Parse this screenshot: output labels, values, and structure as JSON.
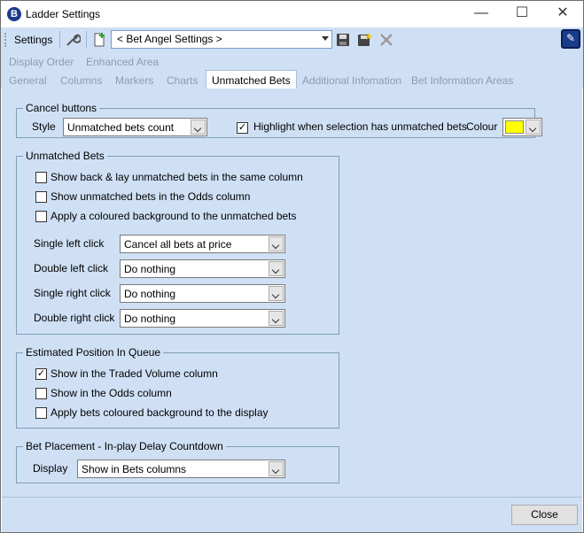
{
  "window": {
    "title": "Ladder Settings",
    "app_icon_letter": "B",
    "minimize": "—",
    "maximize": "☐",
    "close": "✕"
  },
  "toolbar": {
    "settings_label": "Settings",
    "settings_combo_value": "< Bet Angel Settings >",
    "pin_glyph": "✎",
    "icons": [
      "wrench-icon",
      "new-document-icon",
      "save-icon",
      "save-as-icon",
      "delete-icon",
      "pin-icon"
    ]
  },
  "tabs": {
    "row1": [
      "Display Order",
      "Enhanced Area"
    ],
    "row2": [
      "General",
      "Columns",
      "Markers",
      "Charts",
      "Unmatched Bets",
      "Additional Infomation",
      "Bet Information Areas"
    ],
    "active": "Unmatched Bets"
  },
  "cancel_buttons": {
    "title": "Cancel buttons",
    "style_label": "Style",
    "style_value": "Unmatched bets count",
    "highlight_label": "Highlight when selection has unmatched bets",
    "highlight_checked": true,
    "colour_label": "Colour",
    "colour_value": "#ffff00"
  },
  "unmatched_bets": {
    "title": "Unmatched Bets",
    "options": [
      {
        "label": "Show back & lay unmatched bets in the same column",
        "checked": false
      },
      {
        "label": "Show unmatched bets in the Odds column",
        "checked": false
      },
      {
        "label": "Apply a coloured background to the unmatched bets",
        "checked": false
      }
    ],
    "clicks": [
      {
        "label": "Single left click",
        "value": "Cancel all bets at price"
      },
      {
        "label": "Double left click",
        "value": "Do nothing"
      },
      {
        "label": "Single right click",
        "value": "Do nothing"
      },
      {
        "label": "Double right click",
        "value": "Do nothing"
      }
    ]
  },
  "queue": {
    "title": "Estimated Position In Queue",
    "options": [
      {
        "label": "Show in the Traded Volume column",
        "checked": true
      },
      {
        "label": "Show in the Odds column",
        "checked": false
      },
      {
        "label": "Apply bets coloured background to the display",
        "checked": false
      }
    ]
  },
  "bet_placement": {
    "title": "Bet Placement - In-play Delay Countdown",
    "display_label": "Display",
    "display_value": "Show in Bets columns"
  },
  "footer": {
    "close_label": "Close"
  }
}
